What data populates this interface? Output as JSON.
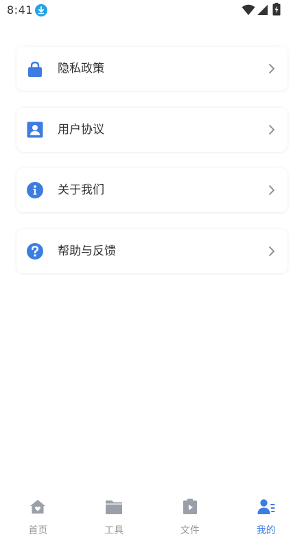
{
  "status_bar": {
    "time": "8:41"
  },
  "menu": {
    "items": [
      {
        "label": "隐私政策",
        "icon": "lock-icon"
      },
      {
        "label": "用户协议",
        "icon": "user-card-icon"
      },
      {
        "label": "关于我们",
        "icon": "info-icon"
      },
      {
        "label": "帮助与反馈",
        "icon": "help-icon"
      }
    ]
  },
  "bottom_nav": {
    "items": [
      {
        "label": "首页",
        "icon": "home-icon"
      },
      {
        "label": "工具",
        "icon": "folder-icon"
      },
      {
        "label": "文件",
        "icon": "file-icon"
      },
      {
        "label": "我的",
        "icon": "profile-icon",
        "active": true
      }
    ]
  },
  "colors": {
    "accent": "#3d7de2",
    "nav_inactive": "#999999",
    "text": "#333333"
  }
}
